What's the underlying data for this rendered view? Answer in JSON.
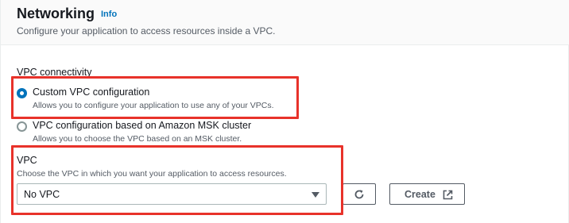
{
  "header": {
    "title": "Networking",
    "info_link": "Info",
    "description": "Configure your application to access resources inside a VPC."
  },
  "vpc_connectivity": {
    "label": "VPC connectivity",
    "options": [
      {
        "label": "Custom VPC configuration",
        "description": "Allows you to configure your application to use any of your VPCs.",
        "selected": true
      },
      {
        "label": "VPC configuration based on Amazon MSK cluster",
        "description": "Allows you to choose the VPC based on an MSK cluster.",
        "selected": false
      }
    ]
  },
  "vpc_field": {
    "label": "VPC",
    "description": "Choose the VPC in which you want your application to access resources.",
    "selected_value": "No VPC"
  },
  "actions": {
    "refresh_icon": "refresh-icon",
    "create_label": "Create",
    "create_icon": "external-link-icon"
  },
  "colors": {
    "accent": "#0073bb",
    "highlight_border": "#e8322a",
    "header_bg": "#fafafa"
  }
}
